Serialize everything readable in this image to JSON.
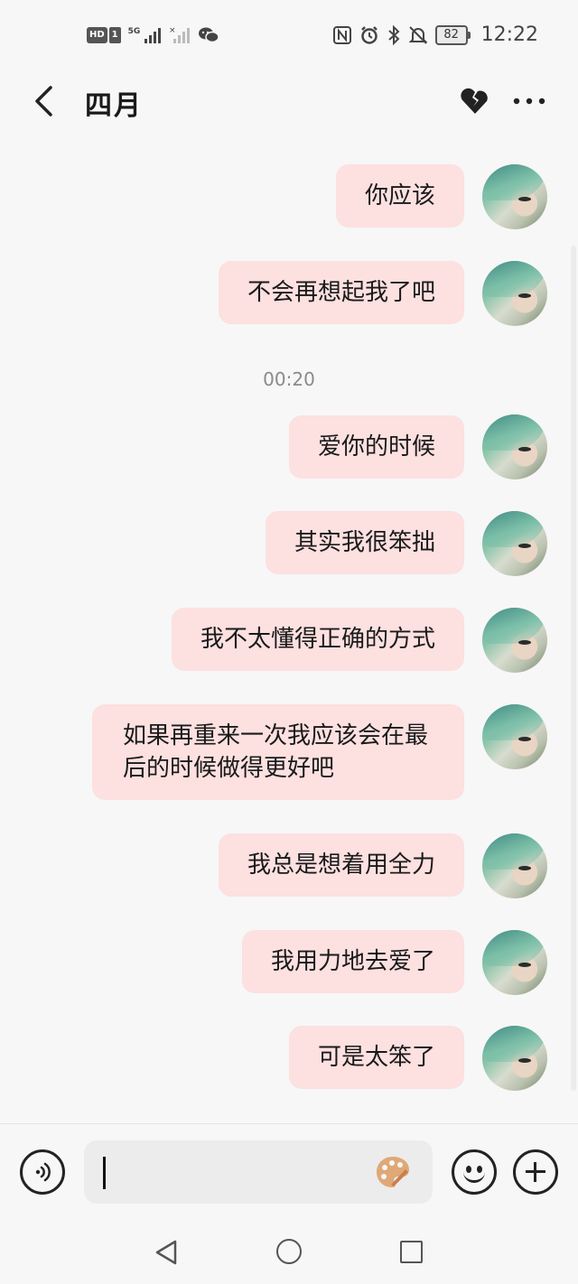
{
  "status_bar": {
    "hd_label": "HD",
    "sim_label": "1",
    "network_type": "5G",
    "battery": "82",
    "time": "12:22",
    "icons": [
      "signal-icon",
      "no-signal-icon",
      "wechat-icon",
      "nfc-icon",
      "alarm-icon",
      "bluetooth-icon",
      "mute-icon"
    ]
  },
  "header": {
    "title": "四月"
  },
  "messages": [
    {
      "text": "你应该"
    },
    {
      "text": "不会再想起我了吧"
    },
    {
      "text": "爱你的时候"
    },
    {
      "text": "其实我很笨拙"
    },
    {
      "text": "我不太懂得正确的方式"
    },
    {
      "text": "如果再重来一次我应该会在最后的时候做得更好吧"
    },
    {
      "text": "我总是想着用全力"
    },
    {
      "text": "我用力地去爱了"
    },
    {
      "text": "可是太笨了"
    }
  ],
  "timestamp": "00:20",
  "input": {
    "value": "",
    "placeholder": ""
  },
  "colors": {
    "bubble_bg": "#fde0e0",
    "page_bg": "#f7f7f7",
    "palette_icon": "#e0a877"
  }
}
